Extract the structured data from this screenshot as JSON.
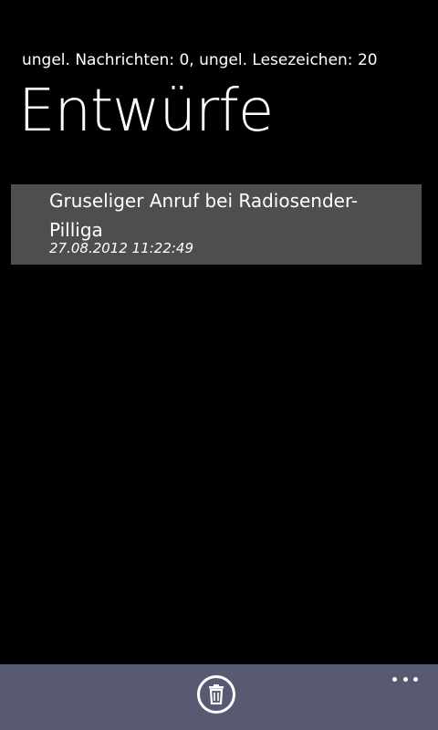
{
  "header": {
    "status_text": "ungel. Nachrichten: 0, ungel. Lesezeichen: 20",
    "title": "Entwürfe"
  },
  "drafts": [
    {
      "title": "Gruseliger Anruf bei Radiosender- Pilliga",
      "date": "27.08.2012 11:22:49"
    }
  ],
  "app_bar": {
    "delete_icon": "trash-icon",
    "more_icon": "ellipsis-icon"
  },
  "colors": {
    "background": "#000000",
    "list_item_background": "#4e4e4e",
    "app_bar_background": "#585a72",
    "text": "#ffffff"
  }
}
